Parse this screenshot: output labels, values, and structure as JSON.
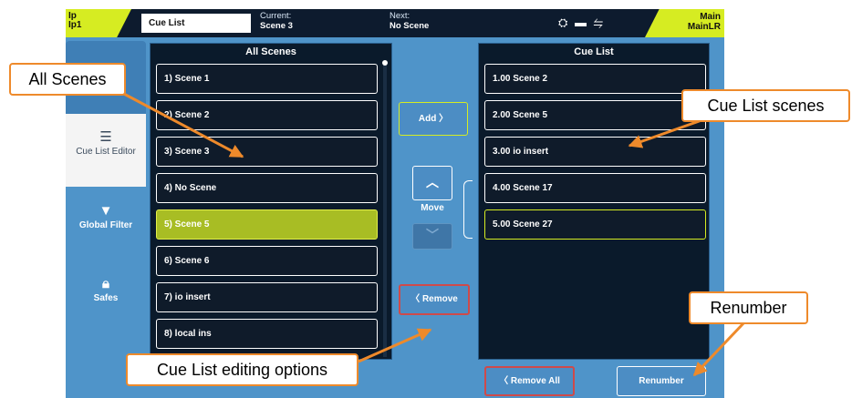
{
  "topbar": {
    "ip_line1": "Ip",
    "ip_line2": "Ip1",
    "screen_title": "Cue List",
    "current_label": "Current:",
    "current_value": "Scene 3",
    "next_label": "Next:",
    "next_value": "No Scene",
    "main_line1": "Main",
    "main_line2": "MainLR"
  },
  "sidebar": {
    "items": [
      {
        "label": "",
        "icon": "menu-icon"
      },
      {
        "label": "Cue List Editor",
        "icon": "list-icon"
      },
      {
        "label": "Global Filter",
        "icon": "filter-icon"
      },
      {
        "label": "Safes",
        "icon": "lock-icon"
      }
    ]
  },
  "all_scenes": {
    "title": "All Scenes",
    "items": [
      "1) Scene 1",
      "2) Scene 2",
      "3) Scene 3",
      "4) No Scene",
      "5) Scene 5",
      "6) Scene 6",
      "7) io insert",
      "8) local ins"
    ],
    "selected_index": 4
  },
  "cue_list": {
    "title": "Cue List",
    "items": [
      "1.00 Scene 2",
      "2.00 Scene 5",
      "3.00 io insert",
      "4.00 Scene 17",
      "5.00 Scene 27"
    ],
    "selected_index": 4
  },
  "controls": {
    "add_label": "Add",
    "add_glyph": "〉",
    "move_label": "Move",
    "move_up_glyph": "︿",
    "move_down_glyph": "﹀",
    "remove_label": "Remove",
    "remove_glyph": "〈",
    "remove_all_label": "Remove All",
    "renumber_label": "Renumber"
  },
  "callouts": {
    "all_scenes": "All Scenes",
    "cue_list_scenes": "Cue List scenes",
    "renumber": "Renumber",
    "editing_options": "Cue List editing options"
  },
  "colors": {
    "accent_yellow": "#d6ec22",
    "selected_green": "#a8bd24",
    "callout_orange": "#ee8a2b",
    "danger_red": "#cf4a4a",
    "screen_blue": "#4f94c9"
  }
}
